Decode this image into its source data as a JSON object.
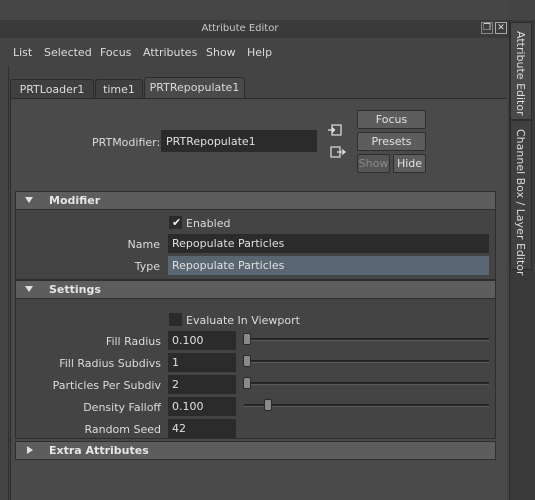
{
  "window": {
    "title": "Attribute Editor"
  },
  "menu": [
    "List",
    "Selected",
    "Focus",
    "Attributes",
    "Show",
    "Help"
  ],
  "tabs": [
    {
      "label": "PRTLoader1",
      "active": false
    },
    {
      "label": "time1",
      "active": false
    },
    {
      "label": "PRTRepopulate1",
      "active": true
    }
  ],
  "node": {
    "label": "PRTModifier:",
    "value": "PRTRepopulate1",
    "buttons": {
      "focus": "Focus",
      "presets": "Presets",
      "show": "Show",
      "hide": "Hide"
    }
  },
  "modifier": {
    "title": "Modifier",
    "enabled_label": "Enabled",
    "enabled": true,
    "name_label": "Name",
    "name_value": "Repopulate Particles",
    "type_label": "Type",
    "type_value": "Repopulate Particles"
  },
  "settings": {
    "title": "Settings",
    "evaluate_label": "Evaluate In Viewport",
    "evaluate": false,
    "rows": [
      {
        "label": "Fill Radius",
        "value": "0.100",
        "slider": 0.0
      },
      {
        "label": "Fill Radius Subdivs",
        "value": "1",
        "slider": 0.0
      },
      {
        "label": "Particles Per Subdiv",
        "value": "2",
        "slider": 0.0
      },
      {
        "label": "Density Falloff",
        "value": "0.100",
        "slider": 0.1
      },
      {
        "label": "Random Seed",
        "value": "42"
      }
    ]
  },
  "extra": {
    "title": "Extra Attributes"
  },
  "side_tabs": {
    "attribute_editor": "Attribute Editor",
    "channel_box": "Channel Box / Layer Editor"
  }
}
